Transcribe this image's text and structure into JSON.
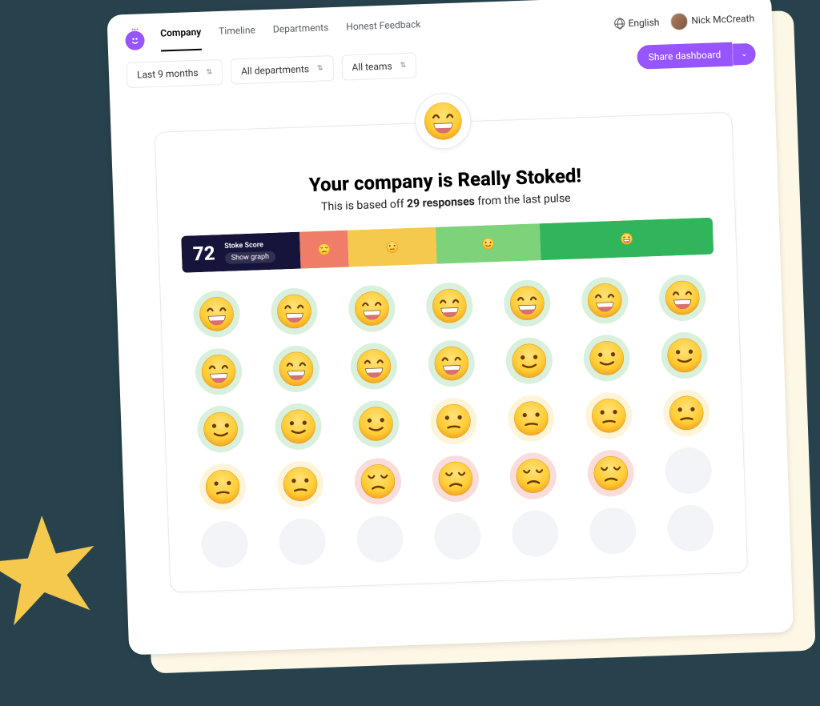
{
  "nav": {
    "tabs": [
      "Company",
      "Timeline",
      "Departments",
      "Honest Feedback"
    ],
    "active": "Company",
    "language": "English",
    "user_name": "Nick McCreath"
  },
  "filters": {
    "time": "Last 9 months",
    "department": "All departments",
    "team": "All teams",
    "share_label": "Share dashboard"
  },
  "hero": {
    "emoji": "grin",
    "headline_prefix": "Your company is ",
    "headline_highlight": "Really Stoked!",
    "sub_prefix": "This is based off ",
    "responses_count": "29 responses",
    "sub_suffix": " from the last pulse"
  },
  "score": {
    "value": "72",
    "label": "Stoke Score",
    "link": "Show graph",
    "segments": [
      "sad",
      "neutral",
      "smile",
      "grin"
    ]
  },
  "responses": [
    "grin",
    "grin",
    "grin",
    "grin",
    "grin",
    "grin",
    "grin",
    "grin",
    "grin",
    "grin",
    "grin",
    "smile",
    "smile",
    "smile",
    "smile",
    "smile",
    "smile",
    "neutral-down",
    "neutral-down",
    "neutral-down",
    "neutral-down",
    "neutral-down",
    "neutral-down",
    "sad",
    "sad",
    "sad",
    "sad",
    "empty",
    "empty",
    "empty",
    "empty",
    "empty",
    "empty",
    "empty",
    "empty"
  ],
  "colors": {
    "purple": "#9655ff",
    "dark": "#16143a",
    "red": "#f07d68",
    "amber": "#f5c84e",
    "green_light": "#7ed37a",
    "green_dark": "#30b55b"
  }
}
